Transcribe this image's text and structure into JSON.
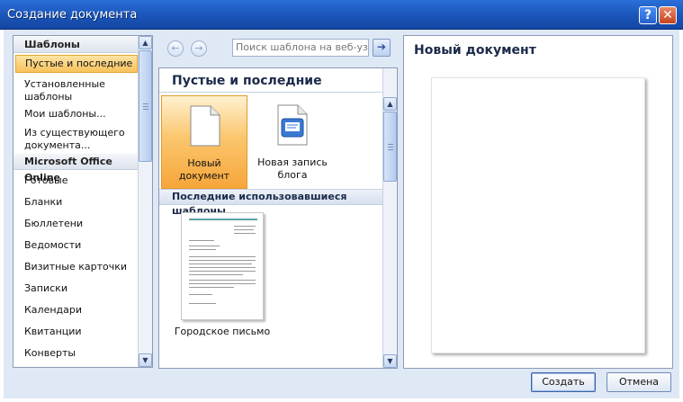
{
  "window": {
    "title": "Создание документа",
    "help_glyph": "?",
    "close_glyph": "✕"
  },
  "left_panel": {
    "header": "Шаблоны",
    "items": [
      {
        "label": "Пустые и последние",
        "selected": true
      },
      {
        "label": "Установленные шаблоны"
      },
      {
        "label": "Мои шаблоны..."
      },
      {
        "label": "Из существующего документа..."
      }
    ],
    "online_header": "Microsoft Office Online",
    "online_items": [
      {
        "label": "Готовые"
      },
      {
        "label": "Бланки"
      },
      {
        "label": "Бюллетени"
      },
      {
        "label": "Ведомости"
      },
      {
        "label": "Визитные карточки"
      },
      {
        "label": "Записки"
      },
      {
        "label": "Календари"
      },
      {
        "label": "Квитанции"
      },
      {
        "label": "Конверты"
      }
    ]
  },
  "toolbar": {
    "search_placeholder": "Поиск шаблона на веб-узле",
    "back_icon": "arrow-left-icon",
    "forward_icon": "arrow-right-icon",
    "go_glyph": "➔"
  },
  "center_panel": {
    "title": "Пустые и последние",
    "tiles": [
      {
        "label": "Новый документ",
        "selected": true,
        "icon": "blank-document-icon"
      },
      {
        "label": "Новая запись блога",
        "icon": "blog-post-icon"
      }
    ],
    "recent_section": "Последние использовавшиеся шаблоны",
    "recent_templates": [
      {
        "label": "Городское письмо"
      }
    ]
  },
  "preview": {
    "title": "Новый документ"
  },
  "buttons": {
    "create": "Создать",
    "cancel": "Отмена"
  },
  "colors": {
    "titlebar": "#1a55b8",
    "selection": "#f8c25c",
    "dialog_bg": "#dfe8f5"
  }
}
